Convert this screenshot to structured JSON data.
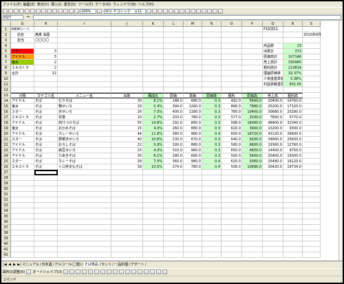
{
  "menu": [
    "ファイル(F)",
    "編集(E)",
    "表示(V)",
    "挿入(I)",
    "書式(O)",
    "ツール(T)",
    "データ(D)",
    "ウィンドウ(W)",
    "ヘルプ(H)"
  ],
  "toolbar": {
    "zoom": "100%",
    "font": "ＭＳ Ｐゴシック",
    "size": "11"
  },
  "formula_bar": {
    "name_box": "H27",
    "fx": "=",
    "content": ""
  },
  "columns": [
    "G",
    "H",
    "I",
    "J",
    "K",
    "L",
    "M",
    "N",
    "O",
    "P",
    "Q",
    "R",
    "S"
  ],
  "header": {
    "title": "MEMシート",
    "store_label": "店名",
    "store_value": "蕎麦 油屋",
    "owner_label": "担当",
    "owner_value": "〇〇〇〇",
    "report_title": "FOOD1",
    "date": "2010年8月"
  },
  "categories": [
    {
      "name": "スター",
      "count": "3",
      "color": "#ff0000"
    },
    {
      "name": "アイドル",
      "count": "5",
      "color": "#ff9900"
    },
    {
      "name": "鬼女",
      "count": "2",
      "color": "#99cc00"
    },
    {
      "name": "エキストラ",
      "count": "2",
      "color": "#ffffff"
    },
    {
      "name": "合計",
      "count": "12",
      "color": "#ffffff"
    }
  ],
  "summary": [
    {
      "label": "商品数",
      "value": "13"
    },
    {
      "label": "出数計",
      "value": "372"
    },
    {
      "label": "原価高計",
      "value": "107146"
    },
    {
      "label": "売上高計",
      "value": "330960"
    },
    {
      "label": "粗利高計",
      "value": "223814"
    },
    {
      "label": "理論原価率",
      "value": "32.37%"
    },
    {
      "label": "人気度基準値",
      "value": "5.38%"
    },
    {
      "label": "利益貢献基準粗利",
      "value": "601.65"
    }
  ],
  "table_headers": [
    "分類",
    "カテゴリ名",
    "メニュー名",
    "出数",
    "構成比",
    "原価",
    "単価",
    "原価率",
    "粗利",
    "原価高",
    "売上高",
    "粗利高"
  ],
  "rows": [
    [
      "アイドル",
      "そば",
      "もりそば",
      "30",
      "8.1%",
      "188.0",
      "680.0",
      "0.3",
      "492.0",
      "5640.0",
      "20400.0",
      "14760.0"
    ],
    [
      "鬼女",
      "そば",
      "鴨せいろ",
      "20",
      "5.4%",
      "394.0",
      "1260.0",
      "0.3",
      "866.0",
      "7880.0",
      "25200.0",
      "17320.0"
    ],
    [
      "スター",
      "そば",
      "天せいろ",
      "26",
      "7.0%",
      "400.0",
      "1180.0",
      "0.3",
      "780.0",
      "10400.0",
      "30680.0",
      "20280.0"
    ],
    [
      "エキストラ",
      "そば",
      "花巻",
      "10",
      "2.7%",
      "203.0",
      "780.0",
      "0.3",
      "577.0",
      "2030.0",
      "7800.0",
      "5770.0"
    ],
    [
      "アイドル",
      "そば",
      "肉汁つけそば",
      "55",
      "14.8%",
      "292.0",
      "880.0",
      "0.3",
      "588.0",
      "16060.0",
      "48400.0",
      "32340.0"
    ],
    [
      "鬼女",
      "そば",
      "おかめそば",
      "15",
      "4.0%",
      "260.0",
      "880.0",
      "0.3",
      "620.0",
      "3900.0",
      "13200.0",
      "9300.0"
    ],
    [
      "アイドル",
      "そば",
      "カレーせいろ",
      "44",
      "11.8%",
      "380.0",
      "980.0",
      "0.4",
      "600.0",
      "16720.0",
      "43120.0",
      "26400.0"
    ],
    [
      "スター",
      "そば",
      "野菜天せいろ",
      "40",
      "10.8%",
      "230.0",
      "870.0",
      "0.3",
      "640.0",
      "9200.0",
      "34800.0",
      "25600.0"
    ],
    [
      "アイドル",
      "そば",
      "おろしそば",
      "22",
      "5.9%",
      "300.0",
      "880.0",
      "0.3",
      "580.0",
      "6600.0",
      "19360.0",
      "12760.0"
    ],
    [
      "アイドル",
      "そば",
      "納豆せいろ",
      "15",
      "4.0%",
      "310.0",
      "960.0",
      "0.3",
      "650.0",
      "4650.0",
      "14400.0",
      "9750.0"
    ],
    [
      "アイドル",
      "そば",
      "たぬきそば",
      "30",
      "8.1%",
      "180.0",
      "680.0",
      "0.3",
      "500.0",
      "5400.0",
      "20400.0",
      "15000.0"
    ],
    [
      "スター",
      "そば",
      "カレーそば",
      "26",
      "7.0%",
      "360.0",
      "980.0",
      "0.4",
      "620.0",
      "9360.0",
      "25480.0",
      "16120.0"
    ],
    [
      "エキストラ",
      "そば",
      "トロ丼天もそば",
      "39",
      "10.5%",
      "274.0",
      "780.0",
      "0.4",
      "506.0",
      "10686.0",
      "30420.0",
      "19734.0"
    ]
  ],
  "row_numbers": [
    "1",
    "2",
    "3",
    "4",
    "5",
    "6",
    "7",
    "8",
    "9",
    "10",
    "11",
    "12",
    "13",
    "14",
    "15",
    "16",
    "17",
    "18",
    "19",
    "20",
    "21",
    "22",
    "23",
    "24",
    "25",
    "26",
    "27",
    "28",
    "29",
    "30",
    "31",
    "32",
    "33",
    "34",
    "35",
    "36",
    "37",
    "38",
    "39",
    "40",
    "41",
    "42"
  ],
  "sheet_tabs": [
    "マニュアル",
    "日本酒",
    "アルコール(ご膳)",
    "そば単品",
    "セット",
    "一品料理",
    "デザート"
  ],
  "draw_label": "図形の調整(R)",
  "autoshape_label": "オートシェイプ(U)",
  "status_text": "コマンド"
}
